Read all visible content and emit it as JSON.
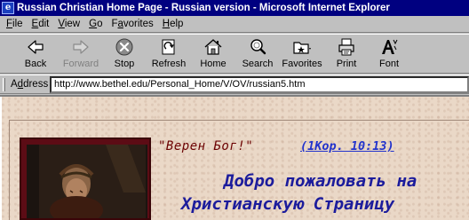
{
  "window": {
    "title": "Russian Christian Home Page - Russian version - Microsoft Internet Explorer",
    "icon": "ie-icon",
    "icon_glyph": "e"
  },
  "menu": {
    "items": [
      {
        "pre": "",
        "ul": "F",
        "post": "ile"
      },
      {
        "pre": "",
        "ul": "E",
        "post": "dit"
      },
      {
        "pre": "",
        "ul": "V",
        "post": "iew"
      },
      {
        "pre": "",
        "ul": "G",
        "post": "o"
      },
      {
        "pre": "F",
        "ul": "a",
        "post": "vorites"
      },
      {
        "pre": "",
        "ul": "H",
        "post": "elp"
      }
    ]
  },
  "toolbar": {
    "back": "Back",
    "forward": "Forward",
    "stop": "Stop",
    "refresh": "Refresh",
    "home": "Home",
    "search": "Search",
    "favorites": "Favorites",
    "print": "Print",
    "font": "Font"
  },
  "address": {
    "label": "Address",
    "label_ul": "d",
    "url": "http://www.bethel.edu/Personal_Home/V/OV/russian5.htm"
  },
  "page": {
    "verse_quote": "\"Верен Бог!\"",
    "verse_ref": "(1Кор. 10:13)",
    "welcome_line1": "Добро пожаловать на",
    "welcome_line2": "Христианскую Страницу"
  },
  "colors": {
    "titlebar": "#000080",
    "page_background": "#ead8c7",
    "verse_quote": "#6b0000",
    "verse_ref": "#2233cc",
    "welcome": "#1c1c9c"
  }
}
